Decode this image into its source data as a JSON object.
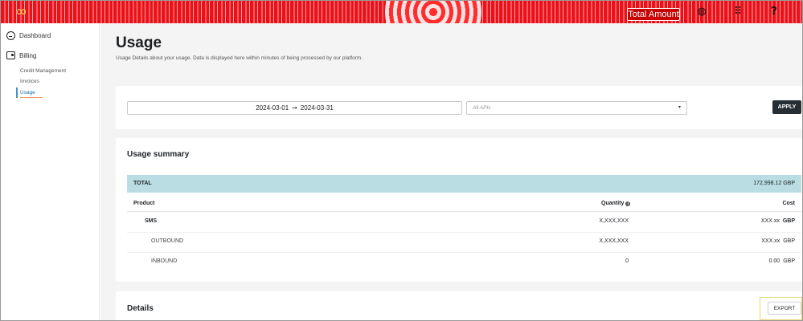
{
  "topbar": {
    "logo_glyph": "∞",
    "total_amount_label": "Total Amount",
    "icons": [
      "globe-icon",
      "apps-grid-icon",
      "help-icon"
    ],
    "globe_glyph": "◍",
    "grid_glyph": "⠿",
    "help_glyph": "?"
  },
  "sidebar": {
    "dashboard_label": "Dashboard",
    "billing_label": "Billing",
    "sub_items": [
      "Credit Management",
      "Invoices",
      "Usage"
    ],
    "active_item": "Usage"
  },
  "page": {
    "title": "Usage",
    "description": "Usage Details about your usage. Data is displayed here within minutes of being processed by our platform."
  },
  "filters": {
    "start_date": "2024-03-01",
    "arrow": "→",
    "end_date": "2024-03-31",
    "api_placeholder": "All APIs",
    "caret": "▾",
    "apply_label": "APPLY"
  },
  "summary": {
    "title": "Usage summary",
    "total_label": "TOTAL",
    "total_value": "172,998.12 GBP",
    "columns": {
      "product": "Product",
      "quantity": "Quantity",
      "cost": "Cost"
    },
    "info_glyph": "i",
    "rows": [
      {
        "name": "SMS",
        "quantity": "X,XXX,XXX",
        "cost": "XXX.xx",
        "currency": "GBP"
      },
      {
        "name": "OUTBOUND",
        "quantity": "X,XXX,XXX",
        "cost": "XXX.xx",
        "currency": "GBP"
      },
      {
        "name": "INBOUND",
        "quantity": "0",
        "cost": "0.00",
        "currency": "GBP"
      }
    ]
  },
  "details": {
    "title": "Details",
    "export_label": "EXPORT"
  },
  "colors": {
    "brand_red": "#e8121b",
    "total_row_bg": "#b9dde2",
    "apply_bg": "#262d33",
    "active_nav": "#1a6fa8",
    "highlight": "#ecd66a"
  }
}
